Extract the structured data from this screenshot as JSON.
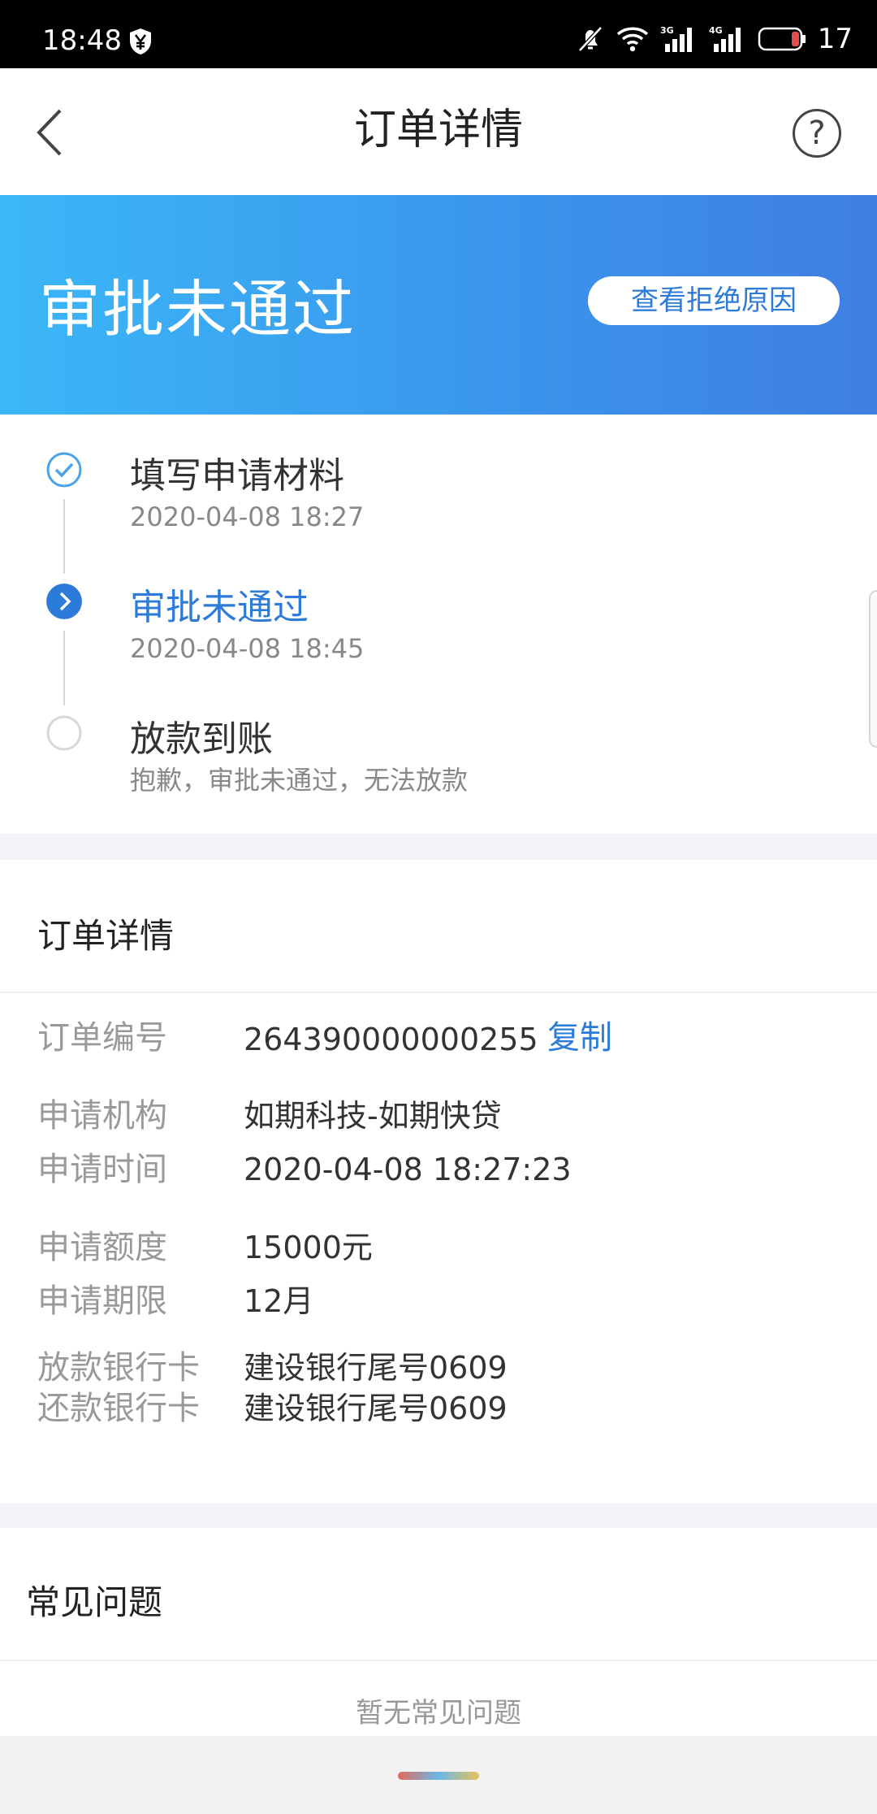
{
  "status_bar": {
    "time": "18:48",
    "battery": "17",
    "icons": [
      "yen-shield-icon",
      "mute-bell-icon",
      "wifi-icon",
      "signal-3g-icon",
      "signal-4g-icon",
      "battery-icon"
    ]
  },
  "header": {
    "title": "订单详情",
    "back_icon": "chevron-left-icon",
    "help_icon": "question-circle-icon",
    "help_glyph": "?"
  },
  "banner": {
    "status": "审批未通过",
    "reason_button": "查看拒绝原因",
    "gradient": [
      "#3bb7f7",
      "#3f7ee3"
    ]
  },
  "timeline": [
    {
      "title": "填写申请材料",
      "subtitle": "2020-04-08 18:27",
      "state": "done"
    },
    {
      "title": "审批未通过",
      "subtitle": "2020-04-08 18:45",
      "state": "current"
    },
    {
      "title": "放款到账",
      "subtitle": "抱歉，审批未通过，无法放款",
      "state": "pending"
    }
  ],
  "order": {
    "section_title": "订单详情",
    "order_no_label": "订单编号",
    "order_no": "264390000000255",
    "copy_label": "复制",
    "rows": [
      {
        "label": "申请机构",
        "value": "如期科技-如期快贷"
      },
      {
        "label": "申请时间",
        "value": "2020-04-08 18:27:23"
      },
      {
        "label": "申请额度",
        "value": "15000元"
      },
      {
        "label": "申请期限",
        "value": "12月"
      },
      {
        "label": "放款银行卡",
        "value": "建设银行尾号0609"
      },
      {
        "label": "还款银行卡",
        "value": "建设银行尾号0609"
      }
    ]
  },
  "faq": {
    "section_title": "常见问题",
    "empty_text": "暂无常见问题"
  },
  "colors": {
    "accent": "#2d7bd9",
    "done_icon": "#4aa3e8",
    "gap": "#f3f4f7"
  }
}
